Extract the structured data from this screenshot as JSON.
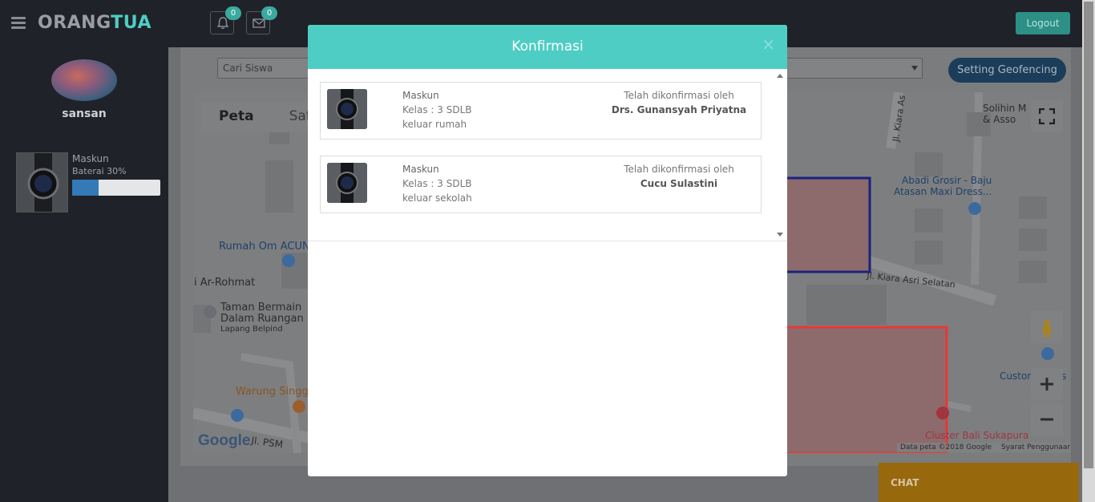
{
  "header": {
    "brand_part1": "ORANG",
    "brand_part2": "TUA",
    "notif_count": "0",
    "msg_count": "0",
    "logout_label": "Logout"
  },
  "sidebar": {
    "username": "sansan",
    "child": {
      "name": "Maskun",
      "battery_label": "Baterai 30%",
      "battery_level": 0.3
    }
  },
  "main": {
    "search_placeholder": "Cari Siswa",
    "geofence_label": "Setting Geofencing",
    "map": {
      "type_options": [
        "Peta",
        "Sat"
      ],
      "labels": {
        "rumah": "Rumah Om ACUN",
        "rohmat": "i Ar-Rohmat",
        "taman1": "Taman Bermain",
        "taman2": "Dalam Ruangan",
        "lapang": "Lapang Belpind",
        "warung": "Warung Singga",
        "jl_psm": "Jl. PSM",
        "kiara_as": "Jl. Kiara As",
        "kiara_selatan": "Jl. Kiara Asri Selatan",
        "solihin1": "Solihin M",
        "solihin2": "& Asso",
        "abadi1": "Abadi Grosir - Baju",
        "abadi2": "Atasan Maxi Dress...",
        "custom": "Custom",
        "custom_end": "s",
        "cluster": "Cluster Bali Sukapura"
      },
      "attribution": "Data peta ©2018 Google",
      "terms": "Syarat Penggunaan",
      "logo": "Google"
    }
  },
  "chat_label": "CHAT",
  "modal": {
    "title": "Konfirmasi",
    "close": "×",
    "items": [
      {
        "name": "Maskun",
        "kelas": "Kelas : 3 SDLB",
        "status": "keluar rumah",
        "confirmed_text": "Telah dikonfirmasi oleh",
        "confirmed_by": "Drs. Gunansyah Priyatna"
      },
      {
        "name": "Maskun",
        "kelas": "Kelas : 3 SDLB",
        "status": "keluar sekolah",
        "confirmed_text": "Telah dikonfirmasi oleh",
        "confirmed_by": "Cucu Sulastini"
      }
    ]
  },
  "colors": {
    "accent": "#4ecdc4",
    "geofence_button": "#1b3d59",
    "chat": "#98680c",
    "zone_red": "#e53935",
    "zone_blue": "#1a237e"
  }
}
